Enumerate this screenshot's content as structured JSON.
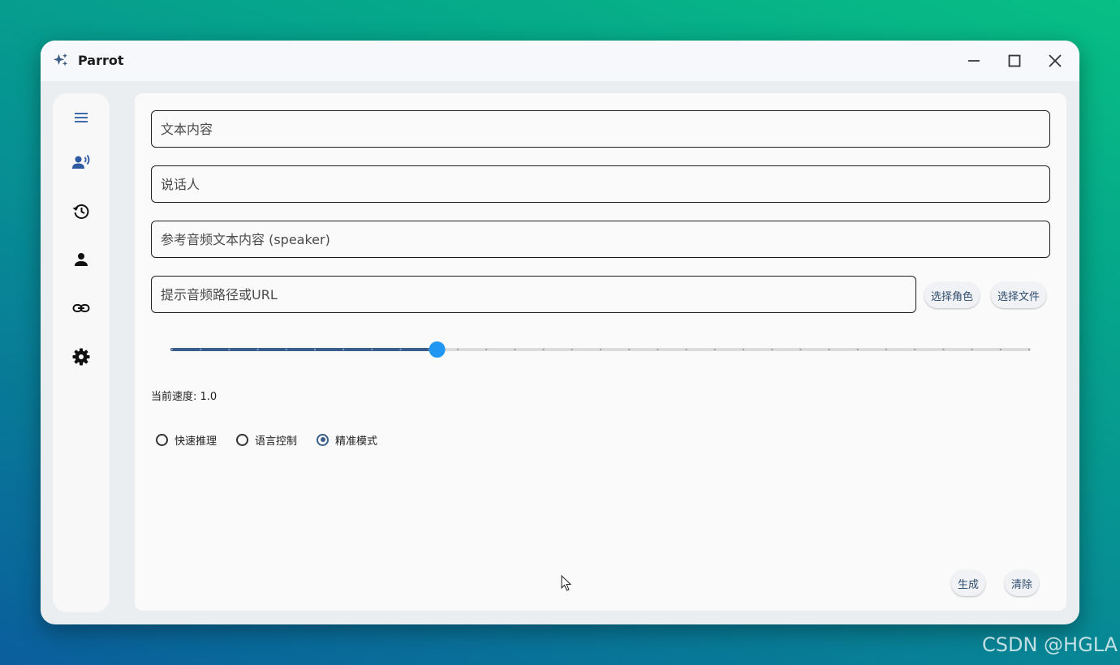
{
  "window": {
    "title": "Parrot",
    "icon": "sparkle-icon"
  },
  "titlebar_buttons": [
    "minimize-icon",
    "maximize-icon",
    "close-icon"
  ],
  "nav_rail": {
    "items": [
      {
        "icon": "menu-icon",
        "active": false
      },
      {
        "icon": "voice-speaker-icon",
        "active": true
      },
      {
        "icon": "history-icon",
        "active": false
      },
      {
        "icon": "person-icon",
        "active": false
      },
      {
        "icon": "link-icon",
        "active": false
      },
      {
        "icon": "gear-icon",
        "active": false
      }
    ]
  },
  "form": {
    "text_content": {
      "placeholder": "文本内容",
      "value": ""
    },
    "speaker": {
      "placeholder": "说话人",
      "value": ""
    },
    "ref_text": {
      "placeholder": "参考音频文本内容 (speaker)",
      "value": ""
    },
    "prompt_audio": {
      "placeholder": "提示音频路径或URL",
      "value": ""
    },
    "select_role_label": "选择角色",
    "select_file_label": "选择文件",
    "speed": {
      "label": "当前速度: 1.0",
      "fraction": 0.31,
      "tick_count": 30
    },
    "modes": [
      {
        "label": "快速推理",
        "checked": false
      },
      {
        "label": "语言控制",
        "checked": false
      },
      {
        "label": "精准模式",
        "checked": true
      }
    ],
    "generate_label": "生成",
    "clear_label": "清除"
  },
  "colors": {
    "accent": "#3a5d89",
    "slider_thumb": "#2196f3",
    "active_nav": "#2d5aa0"
  },
  "watermark": "CSDN @HGLA"
}
